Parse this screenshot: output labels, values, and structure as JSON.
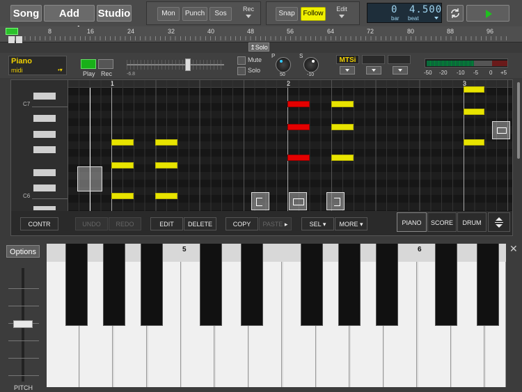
{
  "toolbar": {
    "song": "Song",
    "add_track": "Add Track",
    "studio": "Studio",
    "mon": "Mon",
    "punch": "Punch",
    "sos": "Sos",
    "rec": "Rec",
    "snap": "Snap",
    "follow": "Follow",
    "edit": "Edit",
    "position_bar": "0",
    "position_beat": "4.500",
    "position_bar_label": "bar",
    "position_beat_label": "beat"
  },
  "ruler": {
    "marks": [
      "8",
      "16",
      "24",
      "32",
      "40",
      "48",
      "56",
      "64",
      "72",
      "80",
      "88",
      "96"
    ],
    "solo_label": "↥Solo"
  },
  "track": {
    "name": "Piano",
    "type": "midi",
    "play": "Play",
    "rec": "Rec",
    "volume_value": "-6.8",
    "mute": "Mute",
    "solo": "Solo",
    "pan_label": "P",
    "pan_value": "50",
    "send_label": "S",
    "send_value": "-10",
    "instrument": "MTSi",
    "meter_scale": [
      "-50",
      "-20",
      "-10",
      "-5",
      "0",
      "+5"
    ]
  },
  "editor": {
    "bar_markers": [
      "1",
      "2",
      "3"
    ],
    "octave_labels": [
      "C7",
      "C6"
    ],
    "buttons": {
      "contr": "CONTR",
      "undo": "UNDO",
      "redo": "REDO",
      "edit": "EDIT",
      "delete": "DELETE",
      "copy": "COPY",
      "paste": "PASTE",
      "sel": "SEL",
      "more": "MORE",
      "piano": "PIANO",
      "score": "SCORE",
      "drum": "DRUM"
    }
  },
  "keyboard": {
    "options": "Options",
    "pitch": "PITCH",
    "octave_marks": [
      "5",
      "6"
    ]
  },
  "colors": {
    "note_yellow": "#e8e400",
    "note_red": "#e40000",
    "play_green": "#18b018",
    "follow_yellow": "#f0f000"
  }
}
